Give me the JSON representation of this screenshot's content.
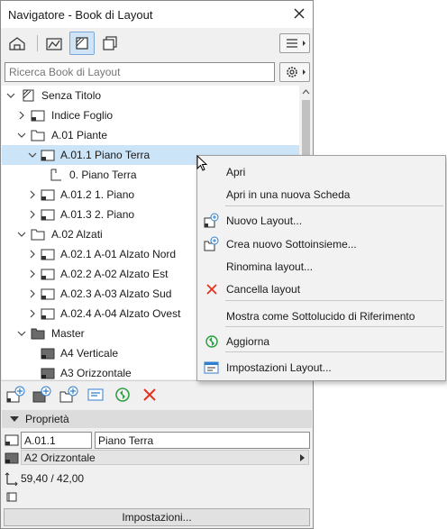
{
  "window": {
    "title": "Navigatore - Book di Layout"
  },
  "search": {
    "placeholder": "Ricerca Book di Layout"
  },
  "tree": {
    "root": "Senza Titolo",
    "items": [
      {
        "label": "Indice Foglio"
      },
      {
        "label": "A.01 Piante"
      },
      {
        "label": "A.01.1 Piano Terra"
      },
      {
        "label": "0. Piano Terra"
      },
      {
        "label": "A.01.2 1. Piano"
      },
      {
        "label": "A.01.3 2. Piano"
      },
      {
        "label": "A.02 Alzati"
      },
      {
        "label": "A.02.1 A-01 Alzato Nord"
      },
      {
        "label": "A.02.2 A-02 Alzato Est"
      },
      {
        "label": "A.02.3 A-03 Alzato Sud"
      },
      {
        "label": "A.02.4 A-04 Alzato Ovest"
      },
      {
        "label": "Master"
      },
      {
        "label": "A4 Verticale"
      },
      {
        "label": "A3 Orizzontale"
      }
    ]
  },
  "properties": {
    "header": "Proprietà",
    "id_value": "A.01.1",
    "name_value": "Piano Terra",
    "master_value": "A2 Orizzontale",
    "size_value": "59,40 / 42,00",
    "settings_label": "Impostazioni..."
  },
  "context_menu": {
    "items": [
      "Apri",
      "Apri in una nuova Scheda",
      "Nuovo Layout...",
      "Crea nuovo Sottoinsieme...",
      "Rinomina layout...",
      "Cancella layout",
      "Mostra come Sottolucido di Riferimento",
      "Aggiorna",
      "Impostazioni Layout..."
    ]
  },
  "colors": {
    "selection": "#cce4f7",
    "accent_blue": "#2f7fcf",
    "delete_red": "#e2331d",
    "refresh_green": "#2ea043"
  }
}
